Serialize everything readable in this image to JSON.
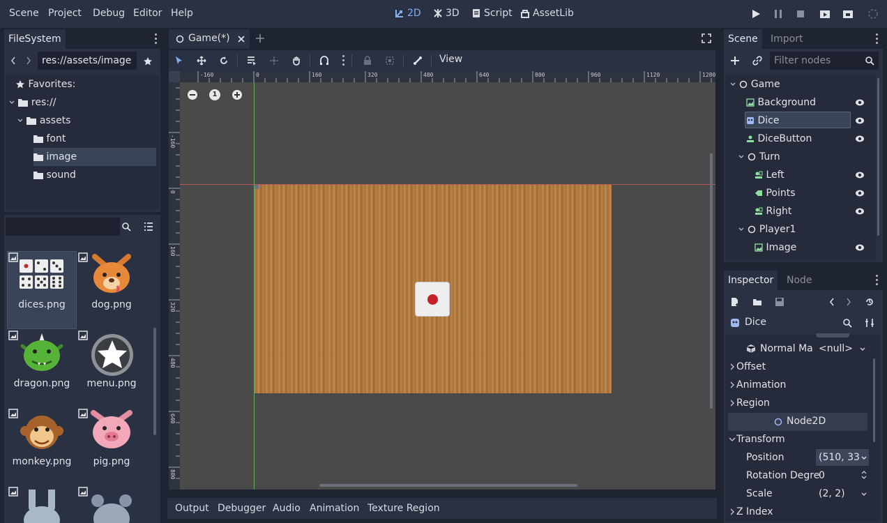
{
  "menu": [
    "Scene",
    "Project",
    "Debug",
    "Editor",
    "Help"
  ],
  "workspaces": {
    "two_d": "2D",
    "three_d": "3D",
    "script": "Script",
    "assetlib": "AssetLib"
  },
  "filesystem": {
    "tab": "FileSystem",
    "path": "res://assets/image",
    "tree": {
      "favorites": "Favorites:",
      "root": "res://",
      "assets": "assets",
      "font": "font",
      "image": "image",
      "sound": "sound"
    },
    "files": [
      {
        "name": "dices.png"
      },
      {
        "name": "dog.png"
      },
      {
        "name": "dragon.png"
      },
      {
        "name": "menu.png"
      },
      {
        "name": "monkey.png"
      },
      {
        "name": "pig.png"
      }
    ]
  },
  "viewport": {
    "tab": "Game(*)",
    "view_menu": "View",
    "zoom_reset": "1",
    "ruler_top": [
      "-160",
      "0",
      "160",
      "320",
      "480",
      "640",
      "800",
      "960",
      "1120",
      "1280"
    ],
    "ruler_left": [
      "-160",
      "0",
      "160",
      "320",
      "480",
      "640",
      "800"
    ]
  },
  "scene": {
    "tab": "Scene",
    "tab2": "Import",
    "filter_placeholder": "Filter nodes",
    "nodes": {
      "game": "Game",
      "background": "Background",
      "dice": "Dice",
      "dicebutton": "DiceButton",
      "turn": "Turn",
      "left": "Left",
      "points": "Points",
      "right": "Right",
      "player1": "Player1",
      "image": "Image"
    }
  },
  "inspector": {
    "tab": "Inspector",
    "tab2": "Node",
    "object": "Dice",
    "normal_map_label": "Normal Ma",
    "normal_map_value": "<null>",
    "offset": "Offset",
    "animation": "Animation",
    "region": "Region",
    "node2d": "Node2D",
    "transform": "Transform",
    "position_label": "Position",
    "position_value": "(510, 33",
    "rotation_label": "Rotation Degre",
    "rotation_value": "0",
    "scale_label": "Scale",
    "scale_value": "(2, 2)",
    "zindex": "Z Index"
  },
  "bottom": [
    "Output",
    "Debugger",
    "Audio",
    "Animation",
    "Texture Region"
  ],
  "colors": {
    "accent": "#7fb2f0",
    "panel": "#2a3142",
    "bg": "#1f2433",
    "wood": "#b07a3e"
  }
}
